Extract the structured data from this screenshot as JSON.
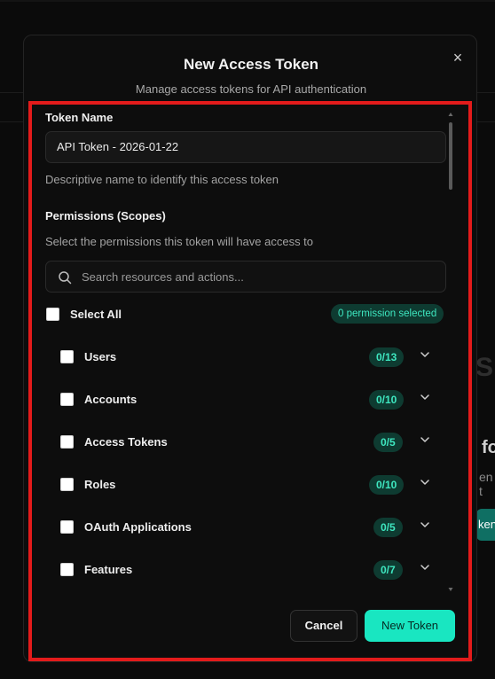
{
  "dialog": {
    "title": "New Access Token",
    "subtitle": "Manage access tokens for API authentication",
    "close_glyph": "×"
  },
  "token_name": {
    "label": "Token Name",
    "value": "API Token - 2026-01-22",
    "hint": "Descriptive name to identify this access token"
  },
  "permissions": {
    "label": "Permissions (Scopes)",
    "hint": "Select the permissions this token will have access to",
    "search_placeholder": "Search resources and actions...",
    "select_all_label": "Select All",
    "selected_badge": "0 permission selected",
    "resources": [
      {
        "name": "Users",
        "count": "0/13"
      },
      {
        "name": "Accounts",
        "count": "0/10"
      },
      {
        "name": "Access Tokens",
        "count": "0/5"
      },
      {
        "name": "Roles",
        "count": "0/10"
      },
      {
        "name": "OAuth Applications",
        "count": "0/5"
      },
      {
        "name": "Features",
        "count": "0/7"
      }
    ]
  },
  "footer": {
    "cancel_label": "Cancel",
    "submit_label": "New Token"
  },
  "background": {
    "fragment_1": "S",
    "fragment_2": "fo",
    "fragment_3": "en t",
    "fragment_button": "ken"
  },
  "colors": {
    "accent": "#19e6c1",
    "badge_bg": "#0e3b31",
    "badge_text": "#3ee7c0",
    "highlight": "#e31b1b",
    "dialog_bg": "#0d0d0d"
  }
}
